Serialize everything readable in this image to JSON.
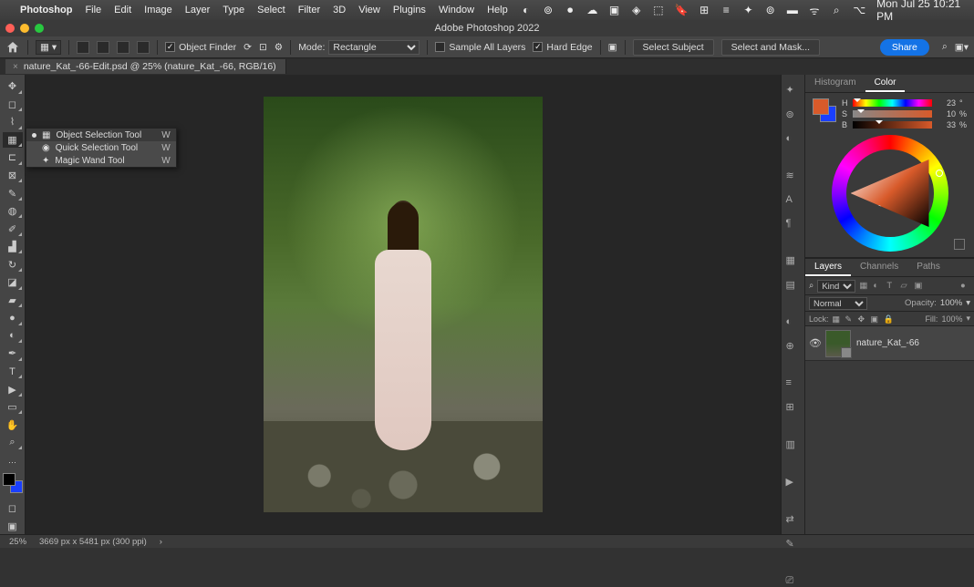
{
  "menubar": {
    "apple": "",
    "app": "Photoshop",
    "items": [
      "File",
      "Edit",
      "Image",
      "Layer",
      "Type",
      "Select",
      "Filter",
      "3D",
      "View",
      "Plugins",
      "Window",
      "Help"
    ],
    "datetime": "Mon Jul 25  10:21 PM"
  },
  "window": {
    "title": "Adobe Photoshop 2022"
  },
  "options": {
    "object_finder": "Object Finder",
    "mode_label": "Mode:",
    "mode_value": "Rectangle",
    "sample_all": "Sample All Layers",
    "hard_edge": "Hard Edge",
    "select_subject": "Select Subject",
    "select_and_mask": "Select and Mask...",
    "share": "Share"
  },
  "doc_tab": {
    "title": "nature_Kat_-66-Edit.psd @ 25% (nature_Kat_-66, RGB/16)"
  },
  "tool_flyout": {
    "items": [
      {
        "label": "Object Selection Tool",
        "shortcut": "W",
        "selected": true
      },
      {
        "label": "Quick Selection Tool",
        "shortcut": "W",
        "selected": false
      },
      {
        "label": "Magic Wand Tool",
        "shortcut": "W",
        "selected": false
      }
    ]
  },
  "color_panel": {
    "tabs": {
      "histogram": "Histogram",
      "color": "Color"
    },
    "h_label": "H",
    "s_label": "S",
    "b_label": "B",
    "h_val": "23",
    "s_val": "10",
    "b_val": "33",
    "h_unit": "°",
    "s_unit": "%",
    "b_unit": "%"
  },
  "layers_panel": {
    "tabs": {
      "layers": "Layers",
      "channels": "Channels",
      "paths": "Paths"
    },
    "kind_label": "Kind",
    "blend_mode": "Normal",
    "opacity_label": "Opacity:",
    "opacity_val": "100%",
    "lock_label": "Lock:",
    "fill_label": "Fill:",
    "fill_val": "100%",
    "layer_name": "nature_Kat_-66"
  },
  "status": {
    "zoom": "25%",
    "dims": "3669 px x 5481 px (300 ppi)"
  }
}
